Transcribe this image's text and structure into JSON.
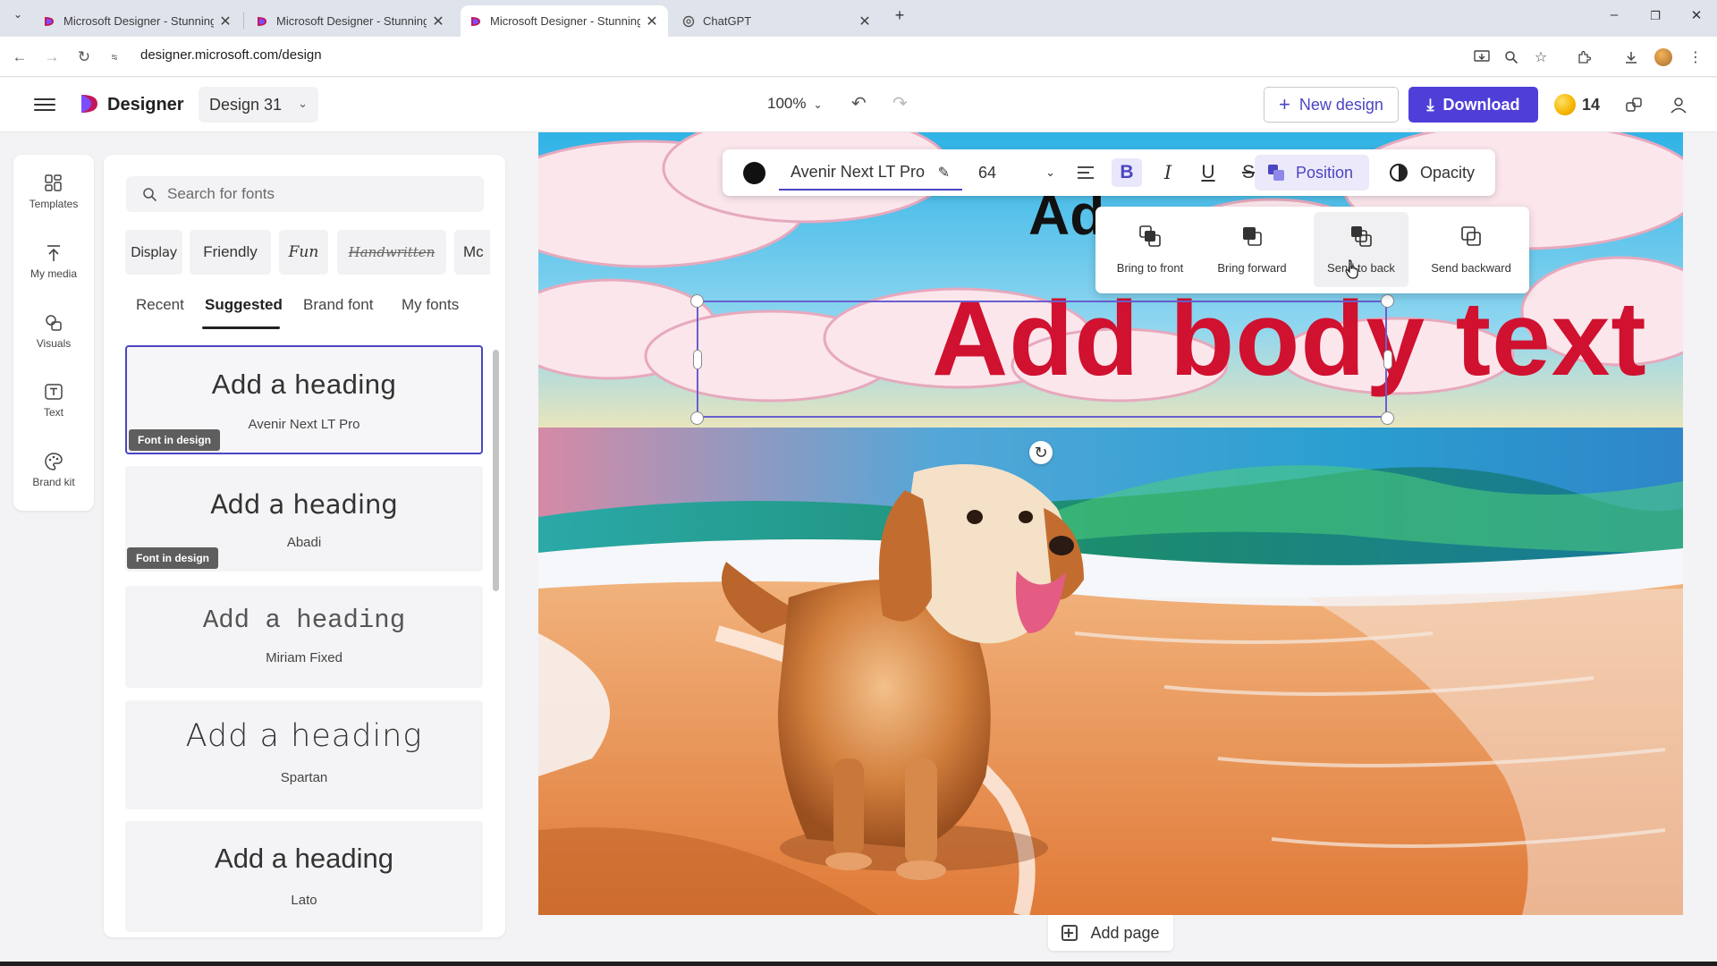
{
  "browser": {
    "tabs": [
      {
        "title": "Microsoft Designer - Stunning designs",
        "close": "✕",
        "active": false
      },
      {
        "title": "Microsoft Designer - Stunning designs",
        "close": "✕",
        "active": false
      },
      {
        "title": "Microsoft Designer - Stunning designs",
        "close": "✕",
        "active": true
      },
      {
        "title": "ChatGPT",
        "close": "✕",
        "active": false
      }
    ],
    "new_tab": "+",
    "url": "designer.microsoft.com/design"
  },
  "header": {
    "brand": "Designer",
    "design_name": "Design 31",
    "zoom": "100%",
    "new_design_label": "New design",
    "download_label": "Download",
    "credits": "14"
  },
  "rail": {
    "items": [
      {
        "label": "Templates",
        "icon": "templates-icon"
      },
      {
        "label": "My media",
        "icon": "upload-icon"
      },
      {
        "label": "Visuals",
        "icon": "visuals-icon"
      },
      {
        "label": "Text",
        "icon": "text-icon"
      },
      {
        "label": "Brand kit",
        "icon": "palette-icon"
      }
    ]
  },
  "fonts_panel": {
    "search_placeholder": "Search for fonts",
    "chips": [
      "Display",
      "Friendly",
      "Fun",
      "Handwritten",
      "Mc"
    ],
    "tabs": [
      "Recent",
      "Suggested",
      "Brand font",
      "My fonts"
    ],
    "active_tab": "Suggested",
    "cards": [
      {
        "heading": "Add a heading",
        "font": "Avenir Next LT Pro",
        "badge": "Font in design",
        "selected": true
      },
      {
        "heading": "Add a heading",
        "font": "Abadi",
        "badge": "Font in design",
        "selected": false
      },
      {
        "heading": "Add a heading",
        "font": "Miriam Fixed",
        "badge": "",
        "selected": false
      },
      {
        "heading": "Add a heading",
        "font": "Spartan",
        "badge": "",
        "selected": false
      },
      {
        "heading": "Add a heading",
        "font": "Lato",
        "badge": "",
        "selected": false
      }
    ]
  },
  "toolbar": {
    "text_color": "#111111",
    "font_name": "Avenir Next LT Pro",
    "font_size": "64",
    "bold": "B",
    "italic": "I",
    "underline": "U",
    "strike": "S",
    "position_label": "Position",
    "opacity_label": "Opacity"
  },
  "position_menu": {
    "items": [
      "Bring to front",
      "Bring forward",
      "Send to back",
      "Send backward"
    ],
    "hovered": "Send to back"
  },
  "canvas": {
    "heading_text": "Ad",
    "body_text": "Add body text",
    "body_color": "#d0112f"
  },
  "add_page_label": "Add page"
}
